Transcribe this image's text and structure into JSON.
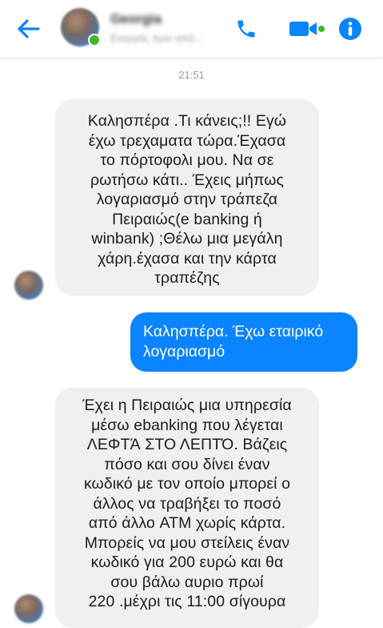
{
  "colors": {
    "accent": "#0a84ff",
    "incoming_bubble": "#f0f0f0",
    "online": "#42b72a"
  },
  "header": {
    "back_icon": "arrow-left-icon",
    "contact_name": "Georgia",
    "contact_status": "Ενεργός πριν από...",
    "actions": [
      "phone-icon",
      "video-camera-icon",
      "info-icon"
    ]
  },
  "conversation": {
    "timestamp": "21:51",
    "messages": [
      {
        "direction": "incoming",
        "lines": [
          "Καλησπέρα  .Τι  κάνεις;!! Εγώ",
          "έχω τρεχαματα τώρα.Έχασα",
          "το πόρτοφολι μου. Να σε",
          "ρωτήσω κάτι.. Έχεις μήπως",
          "λογαριασμό στην τράπεζα",
          "Πειραιώς(e banking ή",
          "winbank) ;Θέλω μια μεγάλη",
          "χάρη.έχασα και την κάρτα",
          "τραπέζης"
        ]
      },
      {
        "direction": "outgoing",
        "lines": [
          "Καλησπέρα. Έχω εταιρικό",
          "λογαριασμό"
        ]
      },
      {
        "direction": "incoming",
        "lines": [
          "Έχει η Πειραιώς μια υπηρεσία",
          "μέσω ebanking που λέγεται",
          "ΛΕΦΤΆ ΣΤΟ ΛΕΠΤΌ. Βάζεις",
          "πόσο και σου δίνει έναν",
          "κωδικό με τον οποίο μπορεί ο",
          "άλλος να τραβήξει το ποσό",
          "από άλλο ATM χωρίς κάρτα.",
          "Μπορείς να μου στείλεις έναν",
          "κωδικό για 200 ευρώ και θα",
          "σου βάλω αυριο πρωί",
          "220 .μέχρι τις 11:00 σίγουρα"
        ]
      }
    ]
  }
}
